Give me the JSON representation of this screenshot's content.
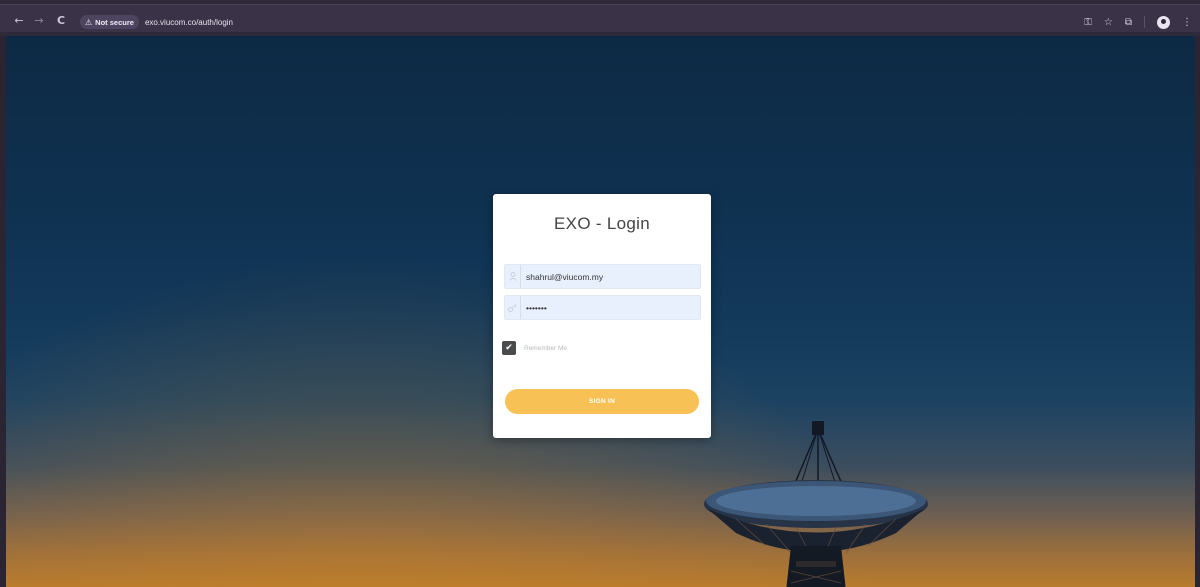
{
  "browser": {
    "back_icon": "←",
    "forward_icon": "→",
    "reload_icon": "C",
    "security_icon": "⚠",
    "security_label": "Not secure",
    "url": "exo.viucom.co/auth/login",
    "password_key_icon": "⚿",
    "star_icon": "☆",
    "extensions_icon": "⧉",
    "menu_icon": "⋮"
  },
  "login": {
    "title": "EXO - Login",
    "username_value": "shahrul@viucom.my",
    "username_icon": "user-icon",
    "password_value": "•••••••",
    "password_icon": "key-icon",
    "remember_label": "Remember Me",
    "remember_checked": true,
    "signin_label": "SIGN IN"
  },
  "colors": {
    "signin_button": "#f7c155",
    "card_background": "#ffffff",
    "field_background": "#e8f0fe",
    "checkbox": "#4a4b4d"
  }
}
